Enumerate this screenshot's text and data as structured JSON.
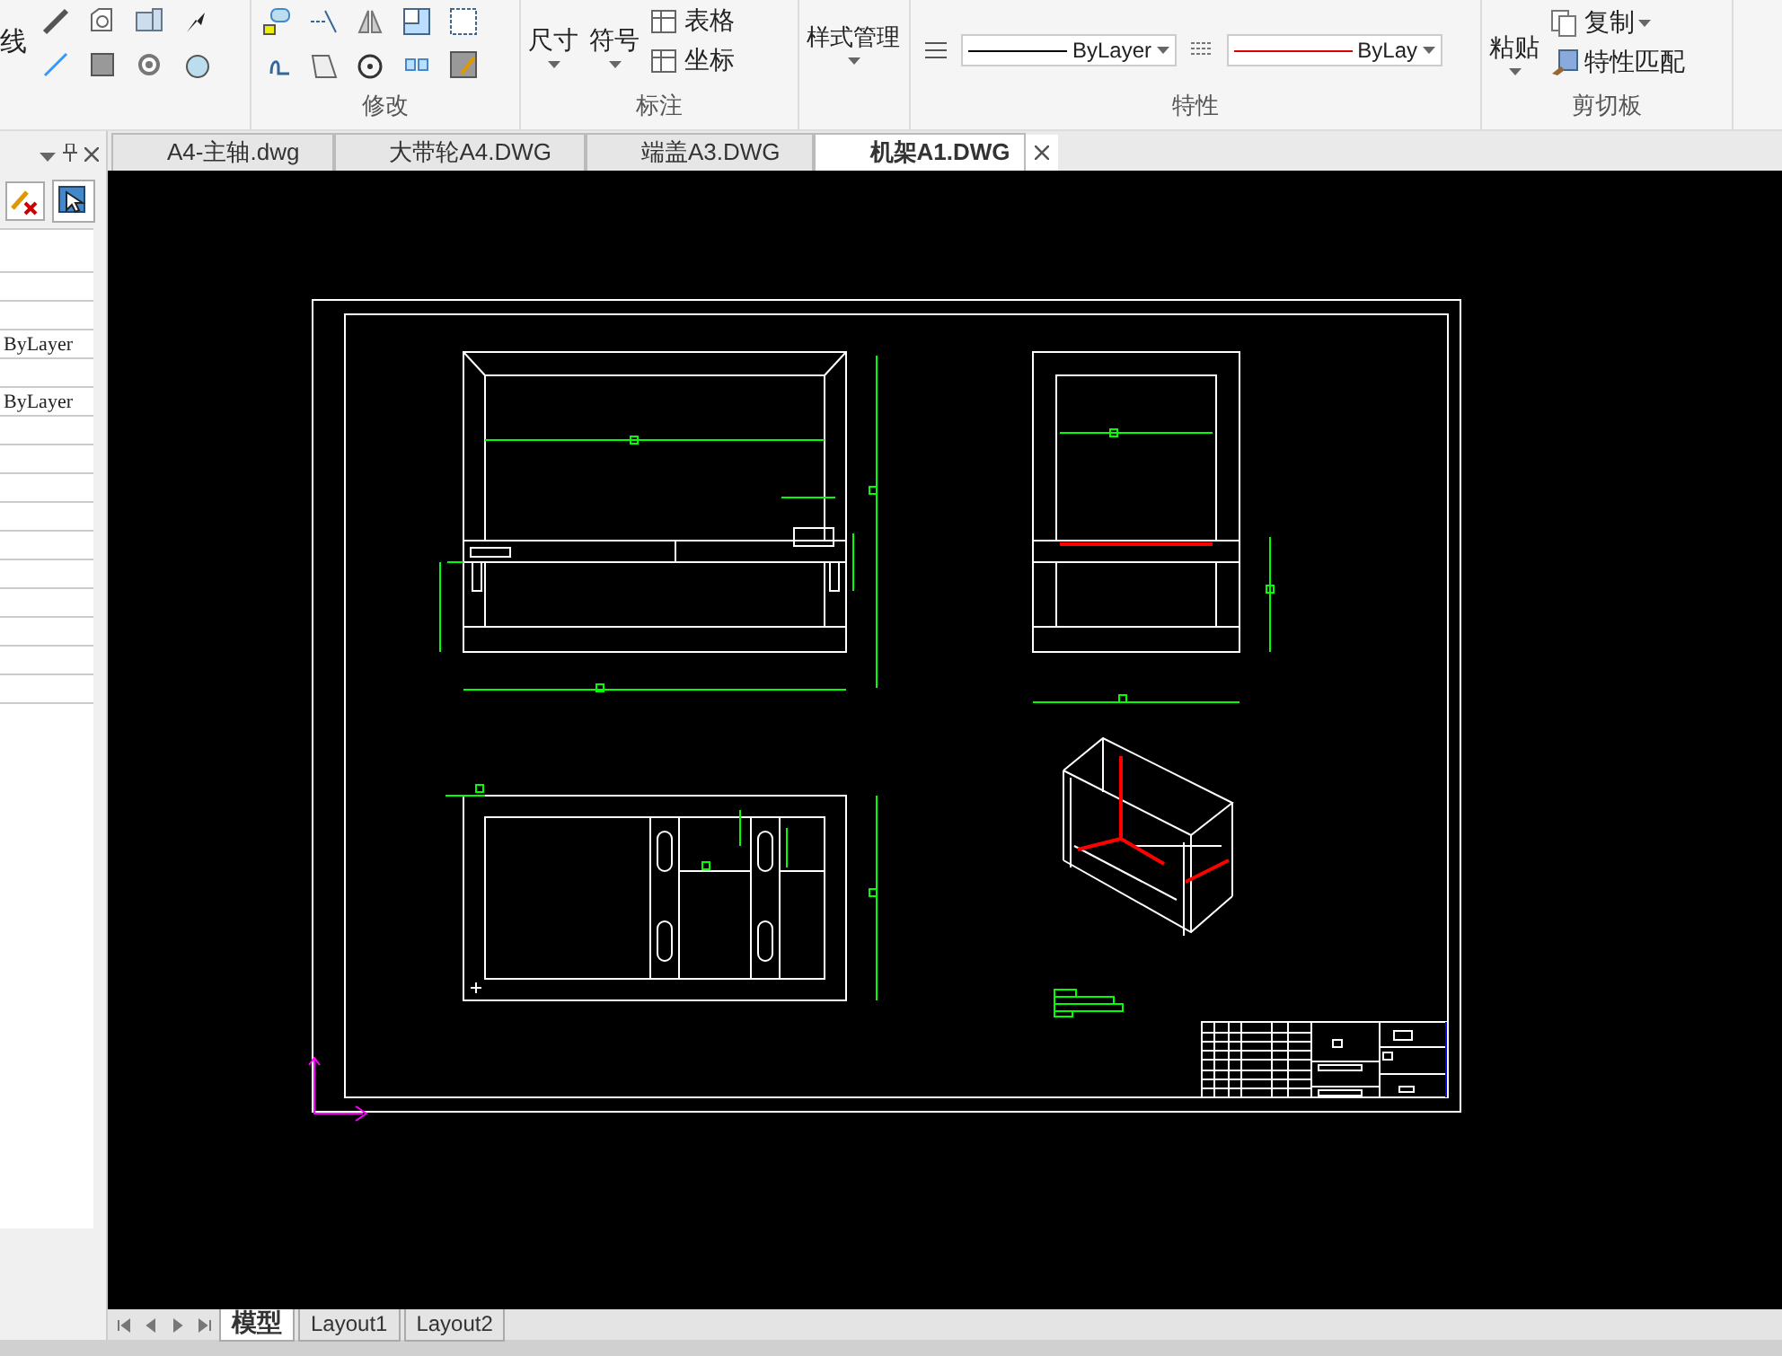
{
  "ribbon": {
    "draw_group": {
      "button_label": "线"
    },
    "modify_group": {
      "label": "修改"
    },
    "annotate_group": {
      "label": "标注",
      "buttons": [
        {
          "label": "尺寸",
          "kind": "large"
        },
        {
          "label": "符号",
          "kind": "large"
        },
        {
          "label": "表格",
          "kind": "small"
        },
        {
          "label": "坐标",
          "kind": "small"
        }
      ]
    },
    "style_manager": {
      "label": "样式管理"
    },
    "properties_group": {
      "label": "特性",
      "linetype": "ByLayer",
      "lineweight": "ByLay"
    },
    "clipboard_group": {
      "label": "剪切板",
      "paste": "粘贴",
      "copy": "复制",
      "match": "特性匹配"
    }
  },
  "properties_panel": {
    "rows": [
      {
        "kind": "blank"
      },
      {
        "kind": "blank"
      },
      {
        "kind": "blank"
      },
      {
        "kind": "value",
        "value": "ByLayer"
      },
      {
        "kind": "blank"
      },
      {
        "kind": "value",
        "value": "ByLayer"
      },
      {
        "kind": "blank"
      },
      {
        "kind": "blank"
      },
      {
        "kind": "blank"
      },
      {
        "kind": "blank"
      },
      {
        "kind": "blank"
      },
      {
        "kind": "blank"
      },
      {
        "kind": "blank"
      },
      {
        "kind": "blank"
      },
      {
        "kind": "blank"
      },
      {
        "kind": "blank"
      }
    ]
  },
  "document_tabs": [
    {
      "label": "A4-主轴.dwg",
      "selected": false
    },
    {
      "label": "大带轮A4.DWG",
      "selected": false
    },
    {
      "label": "端盖A3.DWG",
      "selected": false
    },
    {
      "label": "机架A1.DWG",
      "selected": true
    }
  ],
  "layout_tabs": [
    {
      "label": "模型",
      "selected": true
    },
    {
      "label": "Layout1",
      "selected": false
    },
    {
      "label": "Layout2",
      "selected": false
    }
  ]
}
